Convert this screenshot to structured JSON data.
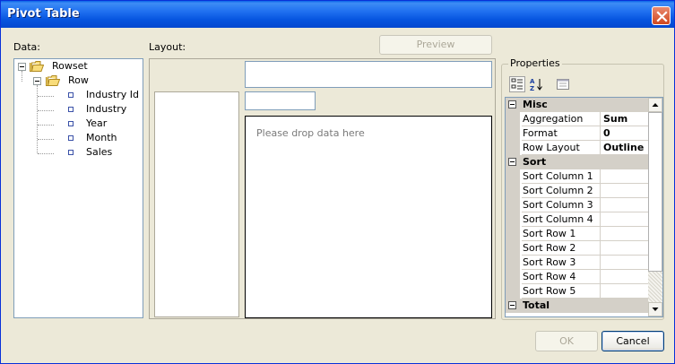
{
  "window": {
    "title": "Pivot Table"
  },
  "labels": {
    "data": "Data:",
    "layout": "Layout:",
    "properties": "Properties"
  },
  "buttons": {
    "preview": "Preview",
    "ok": "OK",
    "cancel": "Cancel"
  },
  "tree": {
    "root": "Rowset",
    "child": "Row",
    "leaves": [
      "Industry Id",
      "Industry",
      "Year",
      "Month",
      "Sales"
    ]
  },
  "layout": {
    "drop_placeholder": "Please drop data here"
  },
  "properties": {
    "toolbar": [
      "categorized-icon",
      "alphabetical-sort-icon",
      "property-pages-icon"
    ],
    "categories": [
      {
        "name": "Misc",
        "rows": [
          {
            "name": "Aggregation",
            "value": "Sum"
          },
          {
            "name": "Format",
            "value": "0"
          },
          {
            "name": "Row Layout",
            "value": "Outline"
          }
        ]
      },
      {
        "name": "Sort",
        "rows": [
          {
            "name": "Sort Column 1",
            "value": ""
          },
          {
            "name": "Sort Column 2",
            "value": ""
          },
          {
            "name": "Sort Column 3",
            "value": ""
          },
          {
            "name": "Sort Column 4",
            "value": ""
          },
          {
            "name": "Sort Row 1",
            "value": ""
          },
          {
            "name": "Sort Row 2",
            "value": ""
          },
          {
            "name": "Sort Row 3",
            "value": ""
          },
          {
            "name": "Sort Row 4",
            "value": ""
          },
          {
            "name": "Sort Row 5",
            "value": ""
          }
        ]
      },
      {
        "name": "Total",
        "rows": []
      }
    ]
  },
  "colors": {
    "title_bar": "#0654df",
    "close_button": "#d0471f",
    "dialog_bg": "#ece9d8"
  }
}
